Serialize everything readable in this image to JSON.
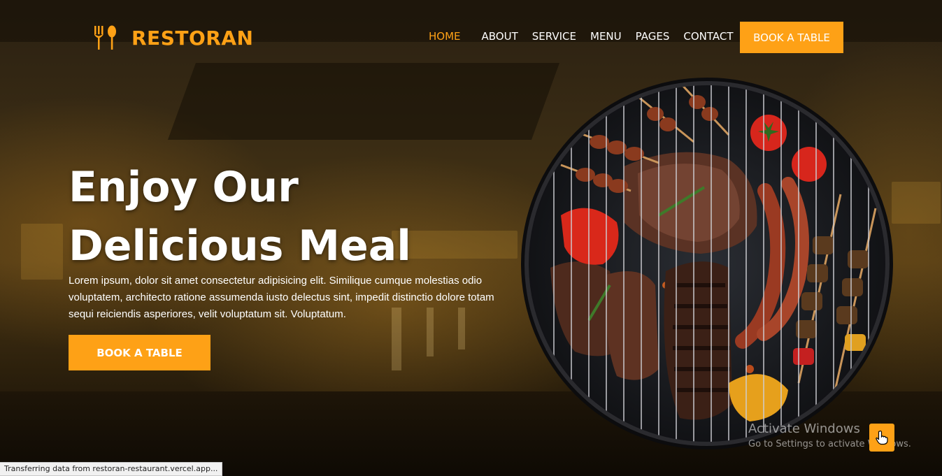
{
  "brand": {
    "name": "RESTORAN",
    "logo_icon": "fork-spoon-icon",
    "color": "#FEA116"
  },
  "nav": {
    "items": [
      {
        "label": "HOME",
        "active": true
      },
      {
        "label": "ABOUT",
        "active": false
      },
      {
        "label": "SERVICE",
        "active": false
      },
      {
        "label": "MENU",
        "active": false
      },
      {
        "label": "PAGES",
        "active": false
      },
      {
        "label": "CONTACT",
        "active": false
      }
    ],
    "cta_label": "BOOK A TABLE"
  },
  "hero": {
    "title_line1": "Enjoy Our",
    "title_line2": "Delicious Meal",
    "text": "Lorem ipsum, dolor sit amet consectetur adipisicing elit. Similique cumque molestias odio voluptatem, architecto ratione assumenda iusto delectus sint, impedit distinctio dolore totam sequi reiciendis asperiores, velit voluptatum sit. Voluptatum.",
    "cta_label": "BOOK A TABLE",
    "image_icon": "grill-food-icon"
  },
  "watermark": {
    "title": "Activate Windows",
    "subtitle": "Go to Settings to activate Windows."
  },
  "back_to_top_icon": "hand-pointer-icon",
  "status_bar": {
    "text": "Transferring data from restoran-restaurant.vercel.app..."
  },
  "colors": {
    "accent": "#FEA116",
    "text": "#FFFFFF"
  }
}
